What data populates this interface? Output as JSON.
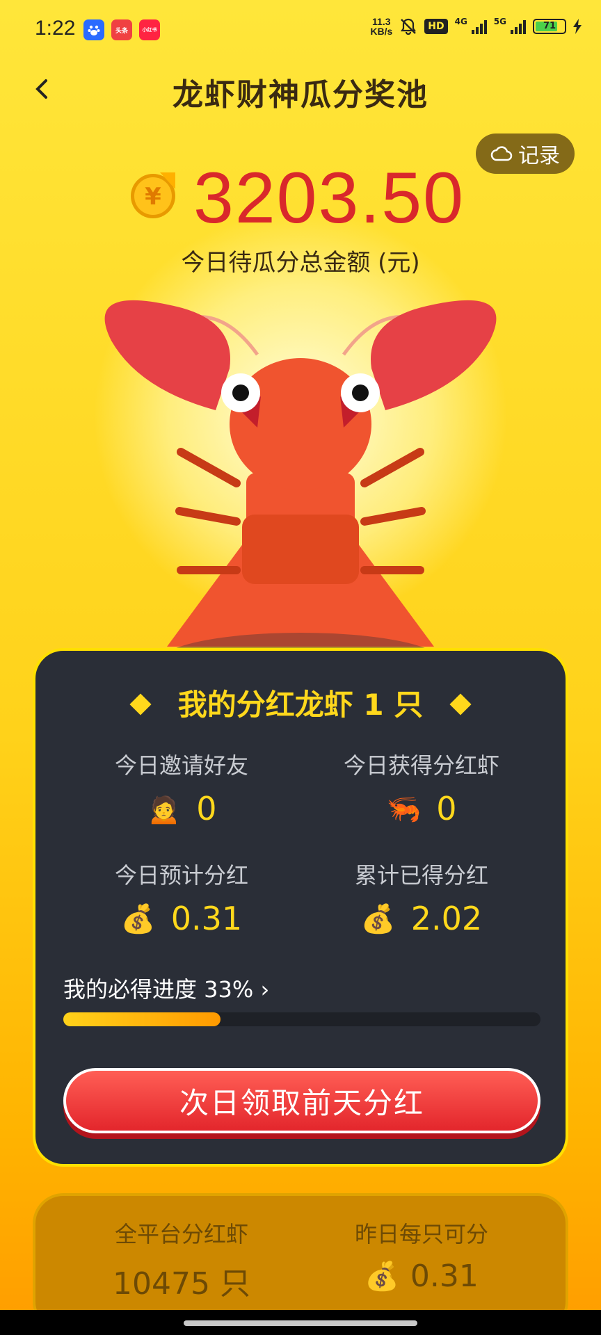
{
  "status": {
    "time": "1:22",
    "apps": [
      {
        "name": "baidu",
        "bg": "#2A6BFF",
        "text": ""
      },
      {
        "name": "toutiao",
        "bg": "#F04142",
        "text": "头条"
      },
      {
        "name": "xiaohongshu",
        "bg": "#FF2442",
        "text": "小红书"
      }
    ],
    "speed_value": "11.3",
    "speed_unit": "KB/s",
    "hd_label": "HD",
    "net1": "4G",
    "net2": "5G",
    "battery": "71"
  },
  "header": {
    "title": "龙虾财神瓜分奖池",
    "record_label": "记录"
  },
  "pool": {
    "amount": "3203.50",
    "label": "今日待瓜分总金额 (元)"
  },
  "my": {
    "heading": "我的分红龙虾 1 只",
    "stats": [
      {
        "label": "今日邀请好友",
        "icon": "person-icon",
        "emoji": "🙍",
        "value": "0"
      },
      {
        "label": "今日获得分红虾",
        "icon": "shrimp-icon",
        "emoji": "🦐",
        "value": "0"
      },
      {
        "label": "今日预计分红",
        "icon": "money-bag-icon",
        "emoji": "💰",
        "value": "0.31"
      },
      {
        "label": "累计已得分红",
        "icon": "money-bag-icon",
        "emoji": "💰",
        "value": "2.02"
      }
    ],
    "progress_text": "我的必得进度 33% ›",
    "progress_fraction": 0.33,
    "cta_label": "次日领取前天分红"
  },
  "platform": {
    "total_label": "全平台分红虾",
    "total_value": "10475 只",
    "per_label": "昨日每只可分",
    "per_emoji": "💰",
    "per_value": "0.31"
  },
  "colors": {
    "accent": "#FFD81C",
    "amount": "#D9282B",
    "card": "#2A2E37",
    "button": "#E3262C"
  }
}
